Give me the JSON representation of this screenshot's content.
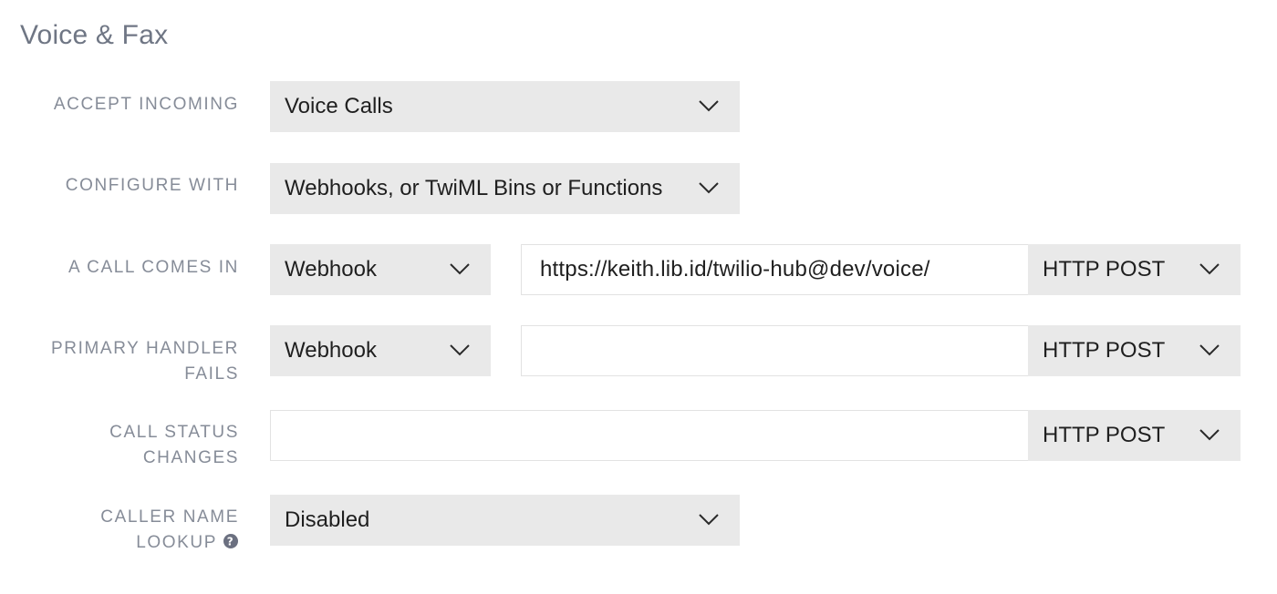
{
  "section": {
    "title": "Voice & Fax"
  },
  "rows": {
    "accept_incoming": {
      "label": "ACCEPT INCOMING",
      "select_value": "Voice Calls"
    },
    "configure_with": {
      "label": "CONFIGURE WITH",
      "select_value": "Webhooks, or TwiML Bins or Functions"
    },
    "call_comes_in": {
      "label": "A CALL COMES IN",
      "type_value": "Webhook",
      "url_value": "https://keith.lib.id/twilio-hub@dev/voice/",
      "method_value": "HTTP POST"
    },
    "primary_handler_fails": {
      "label_line1": "PRIMARY HANDLER",
      "label_line2": "FAILS",
      "type_value": "Webhook",
      "url_value": "",
      "method_value": "HTTP POST"
    },
    "call_status_changes": {
      "label_line1": "CALL STATUS",
      "label_line2": "CHANGES",
      "url_value": "",
      "method_value": "HTTP POST"
    },
    "caller_name_lookup": {
      "label_line1": "CALLER NAME",
      "label_line2": "LOOKUP",
      "select_value": "Disabled"
    }
  },
  "icons": {
    "dropdown": "chevron-down-icon",
    "help": "question-circle-icon"
  },
  "colors": {
    "select_bg": "#e9e9e9",
    "label": "#868c98",
    "title": "#6f7684",
    "text": "#1f1f1f"
  }
}
